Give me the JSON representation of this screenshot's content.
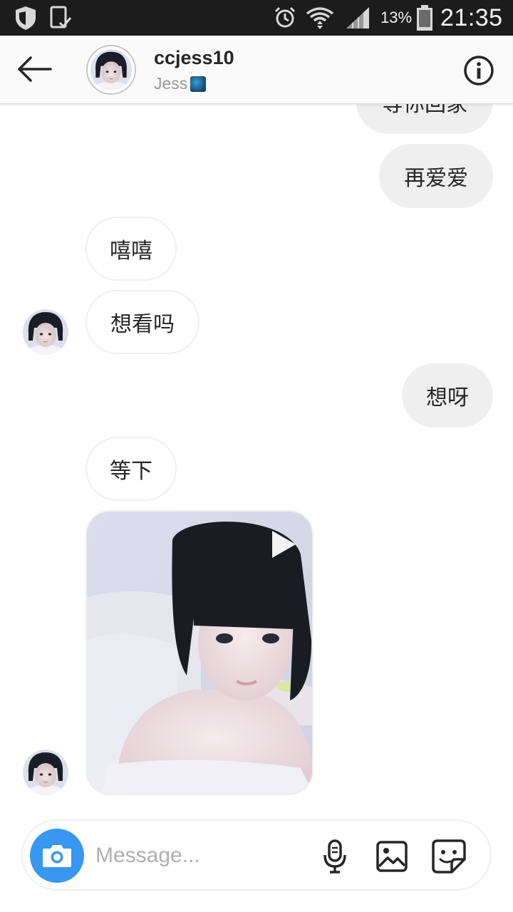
{
  "status_bar": {
    "battery_percent": "13%",
    "time": "21:35",
    "icons": [
      "shield-icon",
      "phone-sync-icon",
      "alarm-icon",
      "wifi-icon",
      "signal-icon",
      "battery-icon"
    ]
  },
  "header": {
    "username": "ccjess10",
    "display_name": "Jess",
    "display_name_emoji": "globe-emoji"
  },
  "messages": [
    {
      "direction": "outgoing",
      "text": "等你回家"
    },
    {
      "direction": "outgoing",
      "text": "再爱爱"
    },
    {
      "direction": "incoming",
      "text": "嘻嘻"
    },
    {
      "direction": "incoming",
      "text": "想看吗"
    },
    {
      "direction": "outgoing",
      "text": "想呀"
    },
    {
      "direction": "incoming",
      "text": "等下"
    },
    {
      "direction": "incoming",
      "type": "video"
    }
  ],
  "composer": {
    "placeholder": "Message..."
  },
  "colors": {
    "status_bar": "#1c1c1c",
    "header_bg": "#fafafa",
    "outgoing_bubble": "#efefef",
    "camera_button": "#3897f0",
    "placeholder": "#b0b0b0"
  }
}
